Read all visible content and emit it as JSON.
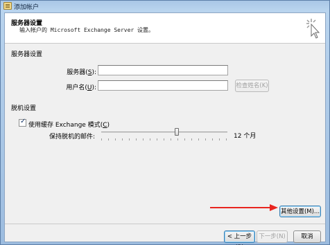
{
  "window": {
    "title": "添加帐户"
  },
  "header": {
    "title": "服务器设置",
    "subtitle": "输入帐户的 Microsoft Exchange Server 设置。"
  },
  "server_section": {
    "heading": "服务器设置",
    "server_label": "服务器(",
    "server_key": "S",
    "server_label_end": "):",
    "server_value": "",
    "username_label": "用户名(",
    "username_key": "U",
    "username_label_end": "):",
    "username_value": "",
    "check_name_button": "检查姓名(K)"
  },
  "offline_section": {
    "heading": "脱机设置",
    "cached_mode_checked": true,
    "cached_mode_label": "使用缓存 Exchange 模式(",
    "cached_mode_key": "C",
    "cached_mode_label_end": ")",
    "mail_to_keep_label": "保持脱机的邮件:",
    "mail_to_keep_value": "12 个月",
    "slider_level_fraction": 0.6
  },
  "buttons": {
    "more_settings": "其他设置(M)...",
    "back": "< 上一步(B)",
    "next": "下一步(N) >",
    "cancel": "取消"
  },
  "colors": {
    "arrow": "#e8251f"
  }
}
